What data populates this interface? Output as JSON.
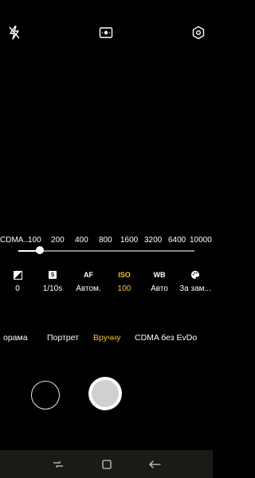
{
  "top_bar": {
    "flash_icon": "flash-off-icon",
    "center_icon": "camera-mode-icon",
    "settings_icon": "settings-hexagon-icon"
  },
  "iso_scale": {
    "labels": [
      "CDMA...",
      "100",
      "200",
      "400",
      "800",
      "1600",
      "3200",
      "6400",
      "10000"
    ],
    "slider_value": 100
  },
  "controls": [
    {
      "key": "exposure",
      "icon": "exposure-icon",
      "value": "0"
    },
    {
      "key": "shutter",
      "icon_text": "S",
      "value": "1/10s"
    },
    {
      "key": "af",
      "icon_text": "AF",
      "value": "Автом."
    },
    {
      "key": "iso",
      "icon_text": "ISO",
      "value": "100",
      "active": true
    },
    {
      "key": "wb",
      "icon_text": "WB",
      "value": "Авто"
    },
    {
      "key": "effect",
      "icon": "palette-icon",
      "value": "За зам..."
    }
  ],
  "modes": {
    "items": [
      "орама",
      "Портрет",
      "Вручну",
      "CDMA без EvDo"
    ],
    "active": "Вручну"
  },
  "colors": {
    "accent": "#f2c12e",
    "background": "#000000",
    "navbar": "#1c1a17"
  },
  "navbar": {
    "recent_icon": "recent-apps-icon",
    "home_icon": "home-square-icon",
    "back_icon": "back-arrow-icon"
  }
}
